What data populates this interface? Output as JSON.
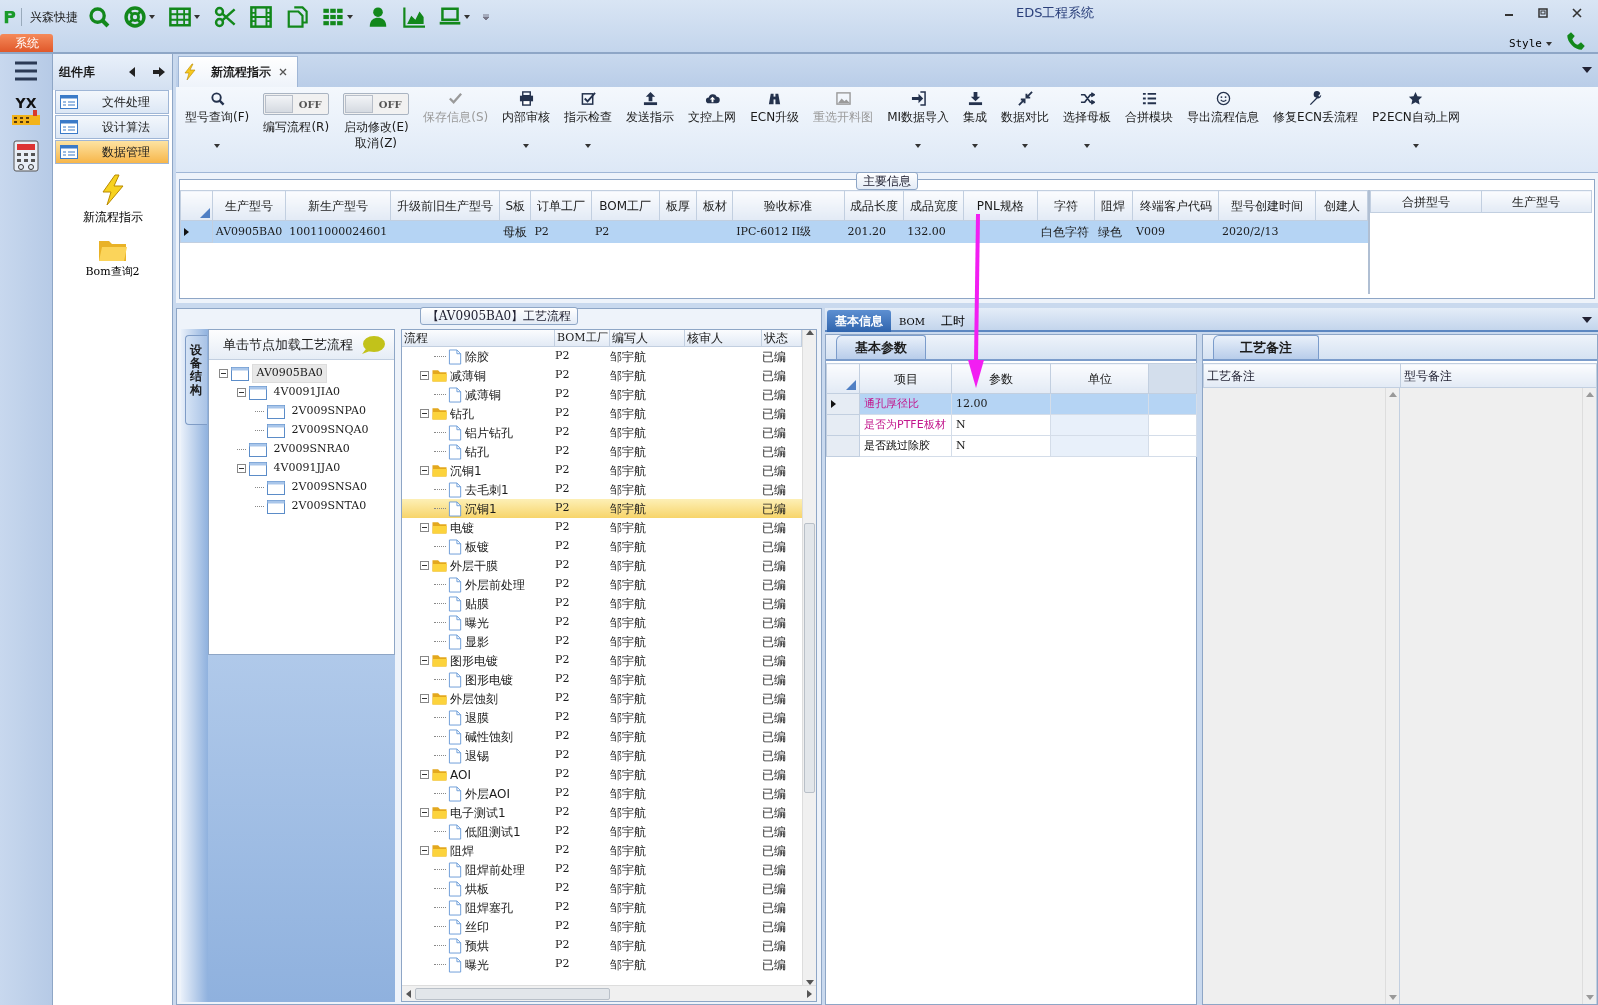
{
  "window": {
    "title": "EDS工程系统"
  },
  "quick_toolbar": {
    "label": "兴森快捷",
    "items": [
      {
        "dropdown": false
      },
      {
        "dropdown": true
      },
      {
        "dropdown": true
      },
      {
        "dropdown": false
      },
      {
        "dropdown": false
      },
      {
        "dropdown": false
      },
      {
        "dropdown": true
      },
      {
        "dropdown": false
      },
      {
        "dropdown": false
      },
      {
        "dropdown": true
      }
    ]
  },
  "app_menu": {
    "label": "系统"
  },
  "style_menu": {
    "label": "Style"
  },
  "left_strip": {
    "logo_text": "YX"
  },
  "component_panel": {
    "title": "组件库",
    "items": [
      {
        "label": "文件处理",
        "selected": false
      },
      {
        "label": "设计算法",
        "selected": false
      },
      {
        "label": "数据管理",
        "selected": true
      }
    ],
    "launchers": [
      {
        "label": "新流程指示"
      },
      {
        "label": "Bom查询2"
      }
    ]
  },
  "doc_tabs": [
    {
      "label": "新流程指示",
      "selected": true
    }
  ],
  "ribbon": [
    {
      "kind": "button",
      "label": "型号查询(F)",
      "dropdown": true,
      "disabled": false
    },
    {
      "kind": "toggle",
      "label": "编写流程(R)",
      "toggle_text": "OFF",
      "on": false
    },
    {
      "kind": "toggle",
      "label": "启动修改(E)\n取消(Z)",
      "toggle_text": "OFF",
      "on": false
    },
    {
      "kind": "button",
      "label": "保存信息(S)",
      "dropdown": false,
      "disabled": true
    },
    {
      "kind": "button",
      "label": "内部审核",
      "dropdown": true,
      "disabled": false
    },
    {
      "kind": "button",
      "label": "指示检查",
      "dropdown": true,
      "disabled": false
    },
    {
      "kind": "button",
      "label": "发送指示",
      "dropdown": false,
      "disabled": false
    },
    {
      "kind": "button",
      "label": "文控上网",
      "dropdown": false,
      "disabled": false
    },
    {
      "kind": "button",
      "label": "ECN升级",
      "dropdown": false,
      "disabled": false
    },
    {
      "kind": "button",
      "label": "重选开料图",
      "dropdown": false,
      "disabled": true
    },
    {
      "kind": "button",
      "label": "MI数据导入",
      "dropdown": true,
      "disabled": false
    },
    {
      "kind": "button",
      "label": "集成",
      "dropdown": true,
      "disabled": false
    },
    {
      "kind": "button",
      "label": "数据对比",
      "dropdown": true,
      "disabled": false
    },
    {
      "kind": "button",
      "label": "选择母板",
      "dropdown": true,
      "disabled": false
    },
    {
      "kind": "button",
      "label": "合拼模块",
      "dropdown": false,
      "disabled": false
    },
    {
      "kind": "button",
      "label": "导出流程信息",
      "dropdown": false,
      "disabled": false
    },
    {
      "kind": "button",
      "label": "修复ECN丢流程",
      "dropdown": false,
      "disabled": false
    },
    {
      "kind": "button",
      "label": "P2ECN自动上网",
      "dropdown": true,
      "disabled": false
    }
  ],
  "main_info": {
    "legend": "主要信息",
    "columns": [
      "生产型号",
      "新生产型号",
      "升级前旧生产型号",
      "S板",
      "订单工厂",
      "BOM工厂",
      "板厚",
      "板材",
      "验收标准",
      "成品长度",
      "成品宽度",
      "PNL规格",
      "字符",
      "阻焊",
      "终端客户代码",
      "型号创建时间",
      "创建人"
    ],
    "rows": [
      {
        "selected": true,
        "cells": [
          "AV0905BA0",
          "10011000024601",
          null,
          "母板",
          "P2",
          "P2",
          null,
          null,
          "IPC-6012 II级",
          "201.20",
          "132.00",
          null,
          "白色字符",
          "绿色",
          "V009",
          "2020/2/13",
          null
        ]
      }
    ],
    "side_columns": [
      "合拼型号",
      "生产型号"
    ]
  },
  "process_panel": {
    "legend": "【AV0905BA0】工艺流程",
    "side_tab": "设备结构",
    "tree_hint": "单击节点加载工艺流程",
    "tree": [
      {
        "label": "AV0905BA0",
        "selected": true,
        "expanded": true,
        "children": [
          {
            "label": "4V0091JIA0",
            "selected": false,
            "expanded": true,
            "children": [
              {
                "label": "2V009SNPA0",
                "selected": false
              },
              {
                "label": "2V009SNQA0",
                "selected": false
              }
            ]
          },
          {
            "label": "2V009SNRA0",
            "selected": false
          },
          {
            "label": "4V0091JJA0",
            "selected": false,
            "expanded": true,
            "children": [
              {
                "label": "2V009SNSA0",
                "selected": false
              },
              {
                "label": "2V009SNTA0",
                "selected": false
              }
            ]
          }
        ]
      }
    ],
    "columns": [
      "流程",
      "BOM工厂",
      "编写人",
      "核审人",
      "状态"
    ],
    "rows": [
      {
        "kind": "group",
        "children": [
          {
            "kind": "file",
            "name": "除胶",
            "bom": "P2",
            "writer": "邹宇航",
            "status": "已编",
            "selected": false
          }
        ]
      },
      {
        "kind": "folder",
        "name": "减薄铜",
        "bom": "P2",
        "writer": "邹宇航",
        "status": "已编",
        "selected": false,
        "expanded": true,
        "children": [
          {
            "kind": "file",
            "name": "减薄铜",
            "bom": "P2",
            "writer": "邹宇航",
            "status": "已编",
            "selected": false
          }
        ]
      },
      {
        "kind": "folder",
        "name": "钻孔",
        "bom": "P2",
        "writer": "邹宇航",
        "status": "已编",
        "selected": false,
        "expanded": true,
        "children": [
          {
            "kind": "file",
            "name": "铝片钻孔",
            "bom": "P2",
            "writer": "邹宇航",
            "status": "已编",
            "selected": false
          },
          {
            "kind": "file",
            "name": "钻孔",
            "bom": "P2",
            "writer": "邹宇航",
            "status": "已编",
            "selected": false
          }
        ]
      },
      {
        "kind": "folder",
        "name": "沉铜1",
        "bom": "P2",
        "writer": "邹宇航",
        "status": "已编",
        "selected": false,
        "expanded": true,
        "children": [
          {
            "kind": "file",
            "name": "去毛刺1",
            "bom": "P2",
            "writer": "邹宇航",
            "status": "已编",
            "selected": false
          },
          {
            "kind": "file",
            "name": "沉铜1",
            "bom": "P2",
            "writer": "邹宇航",
            "status": "已编",
            "selected": true
          }
        ]
      },
      {
        "kind": "folder",
        "name": "电镀",
        "bom": "P2",
        "writer": "邹宇航",
        "status": "已编",
        "selected": false,
        "expanded": true,
        "children": [
          {
            "kind": "file",
            "name": "板镀",
            "bom": "P2",
            "writer": "邹宇航",
            "status": "已编",
            "selected": false
          }
        ]
      },
      {
        "kind": "folder",
        "name": "外层干膜",
        "bom": "P2",
        "writer": "邹宇航",
        "status": "已编",
        "selected": false,
        "expanded": true,
        "children": [
          {
            "kind": "file",
            "name": "外层前处理",
            "bom": "P2",
            "writer": "邹宇航",
            "status": "已编",
            "selected": false
          },
          {
            "kind": "file",
            "name": "贴膜",
            "bom": "P2",
            "writer": "邹宇航",
            "status": "已编",
            "selected": false
          },
          {
            "kind": "file",
            "name": "曝光",
            "bom": "P2",
            "writer": "邹宇航",
            "status": "已编",
            "selected": false
          },
          {
            "kind": "file",
            "name": "显影",
            "bom": "P2",
            "writer": "邹宇航",
            "status": "已编",
            "selected": false
          }
        ]
      },
      {
        "kind": "folder",
        "name": "图形电镀",
        "bom": "P2",
        "writer": "邹宇航",
        "status": "已编",
        "selected": false,
        "expanded": true,
        "children": [
          {
            "kind": "file",
            "name": "图形电镀",
            "bom": "P2",
            "writer": "邹宇航",
            "status": "已编",
            "selected": false
          }
        ]
      },
      {
        "kind": "folder",
        "name": "外层蚀刻",
        "bom": "P2",
        "writer": "邹宇航",
        "status": "已编",
        "selected": false,
        "expanded": true,
        "children": [
          {
            "kind": "file",
            "name": "退膜",
            "bom": "P2",
            "writer": "邹宇航",
            "status": "已编",
            "selected": false
          },
          {
            "kind": "file",
            "name": "碱性蚀刻",
            "bom": "P2",
            "writer": "邹宇航",
            "status": "已编",
            "selected": false
          },
          {
            "kind": "file",
            "name": "退锡",
            "bom": "P2",
            "writer": "邹宇航",
            "status": "已编",
            "selected": false
          }
        ]
      },
      {
        "kind": "folder",
        "name": "AOI",
        "bom": "P2",
        "writer": "邹宇航",
        "status": "已编",
        "selected": false,
        "expanded": true,
        "children": [
          {
            "kind": "file",
            "name": "外层AOI",
            "bom": "P2",
            "writer": "邹宇航",
            "status": "已编",
            "selected": false
          }
        ]
      },
      {
        "kind": "folder",
        "name": "电子测试1",
        "bom": "P2",
        "writer": "邹宇航",
        "status": "已编",
        "selected": false,
        "expanded": true,
        "children": [
          {
            "kind": "file",
            "name": "低阻测试1",
            "bom": "P2",
            "writer": "邹宇航",
            "status": "已编",
            "selected": false
          }
        ]
      },
      {
        "kind": "folder",
        "name": "阻焊",
        "bom": "P2",
        "writer": "邹宇航",
        "status": "已编",
        "selected": false,
        "expanded": true,
        "children": [
          {
            "kind": "file",
            "name": "阻焊前处理",
            "bom": "P2",
            "writer": "邹宇航",
            "status": "已编",
            "selected": false
          },
          {
            "kind": "file",
            "name": "烘板",
            "bom": "P2",
            "writer": "邹宇航",
            "status": "已编",
            "selected": false
          },
          {
            "kind": "file",
            "name": "阻焊塞孔",
            "bom": "P2",
            "writer": "邹宇航",
            "status": "已编",
            "selected": false
          },
          {
            "kind": "file",
            "name": "丝印",
            "bom": "P2",
            "writer": "邹宇航",
            "status": "已编",
            "selected": false
          },
          {
            "kind": "file",
            "name": "预烘",
            "bom": "P2",
            "writer": "邹宇航",
            "status": "已编",
            "selected": false
          },
          {
            "kind": "file",
            "name": "曝光",
            "bom": "P2",
            "writer": "邹宇航",
            "status": "已编",
            "selected": false
          }
        ]
      }
    ]
  },
  "detail_tabs": [
    {
      "label": "基本信息",
      "selected": true
    },
    {
      "label": "BOM",
      "selected": false
    },
    {
      "label": "工时",
      "selected": false
    }
  ],
  "params": {
    "tab": "基本参数",
    "columns": [
      "项目",
      "参数",
      "单位"
    ],
    "rows": [
      {
        "item": "通孔厚径比",
        "value": "12.00",
        "highlighted": true,
        "selected": true
      },
      {
        "item": "是否为PTFE板材",
        "value": "N",
        "highlighted": true,
        "selected": false
      },
      {
        "item": "是否跳过除胶",
        "value": "N",
        "highlighted": false,
        "selected": false
      }
    ]
  },
  "notes": {
    "tab": "工艺备注",
    "columns": [
      "工艺备注",
      "型号备注"
    ]
  }
}
